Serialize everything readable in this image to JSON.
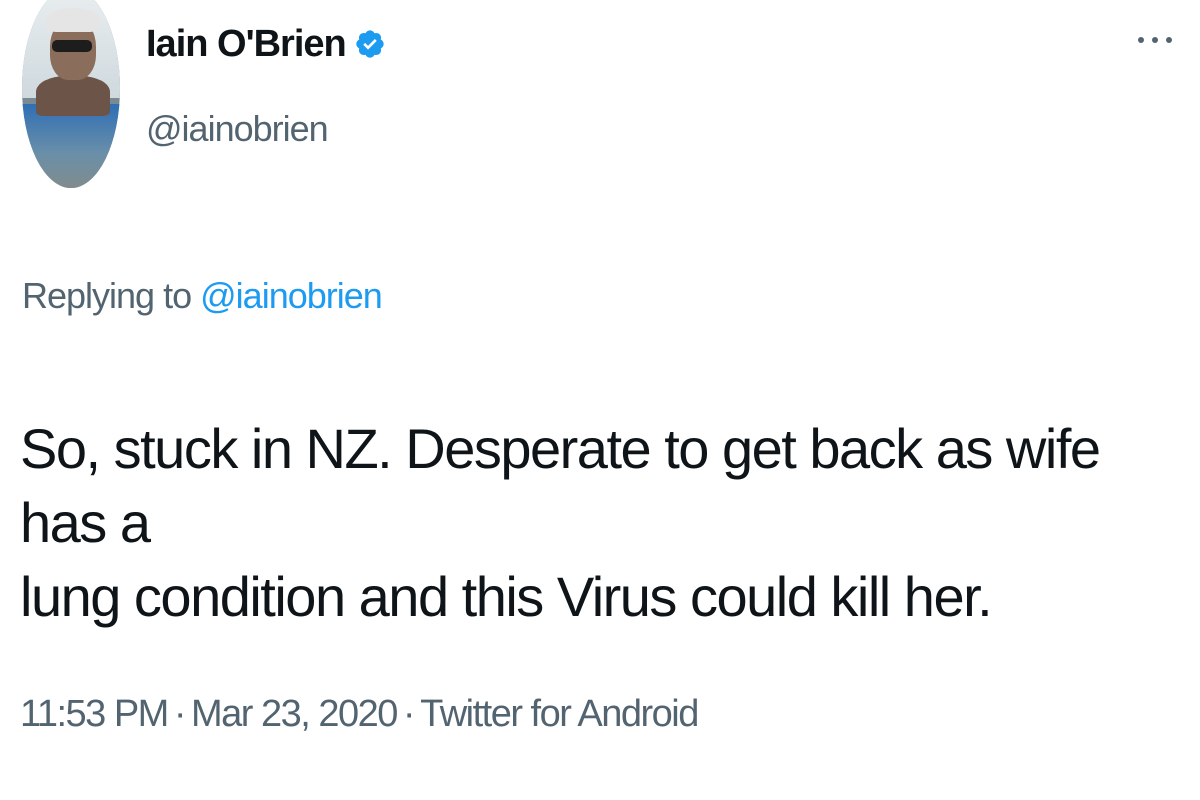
{
  "author": {
    "name": "Iain O'Brien",
    "handle": "@iainobrien",
    "verified": true,
    "avatar_icon": "profile-photo"
  },
  "reply": {
    "prefix": "Replying to",
    "mention": "@iainobrien"
  },
  "tweet": {
    "text_line1": "So, stuck in NZ. Desperate to get back as wife has a",
    "text_line2": "lung condition and this Virus could kill her."
  },
  "meta": {
    "time": "11:53 PM",
    "date": "Mar 23, 2020",
    "source": "Twitter for Android",
    "separator": "·"
  },
  "colors": {
    "text": "#0f1419",
    "secondary": "#536471",
    "accent": "#1d9bf0"
  },
  "icons": {
    "verified": "verified-badge-icon",
    "more": "more-options-icon"
  }
}
